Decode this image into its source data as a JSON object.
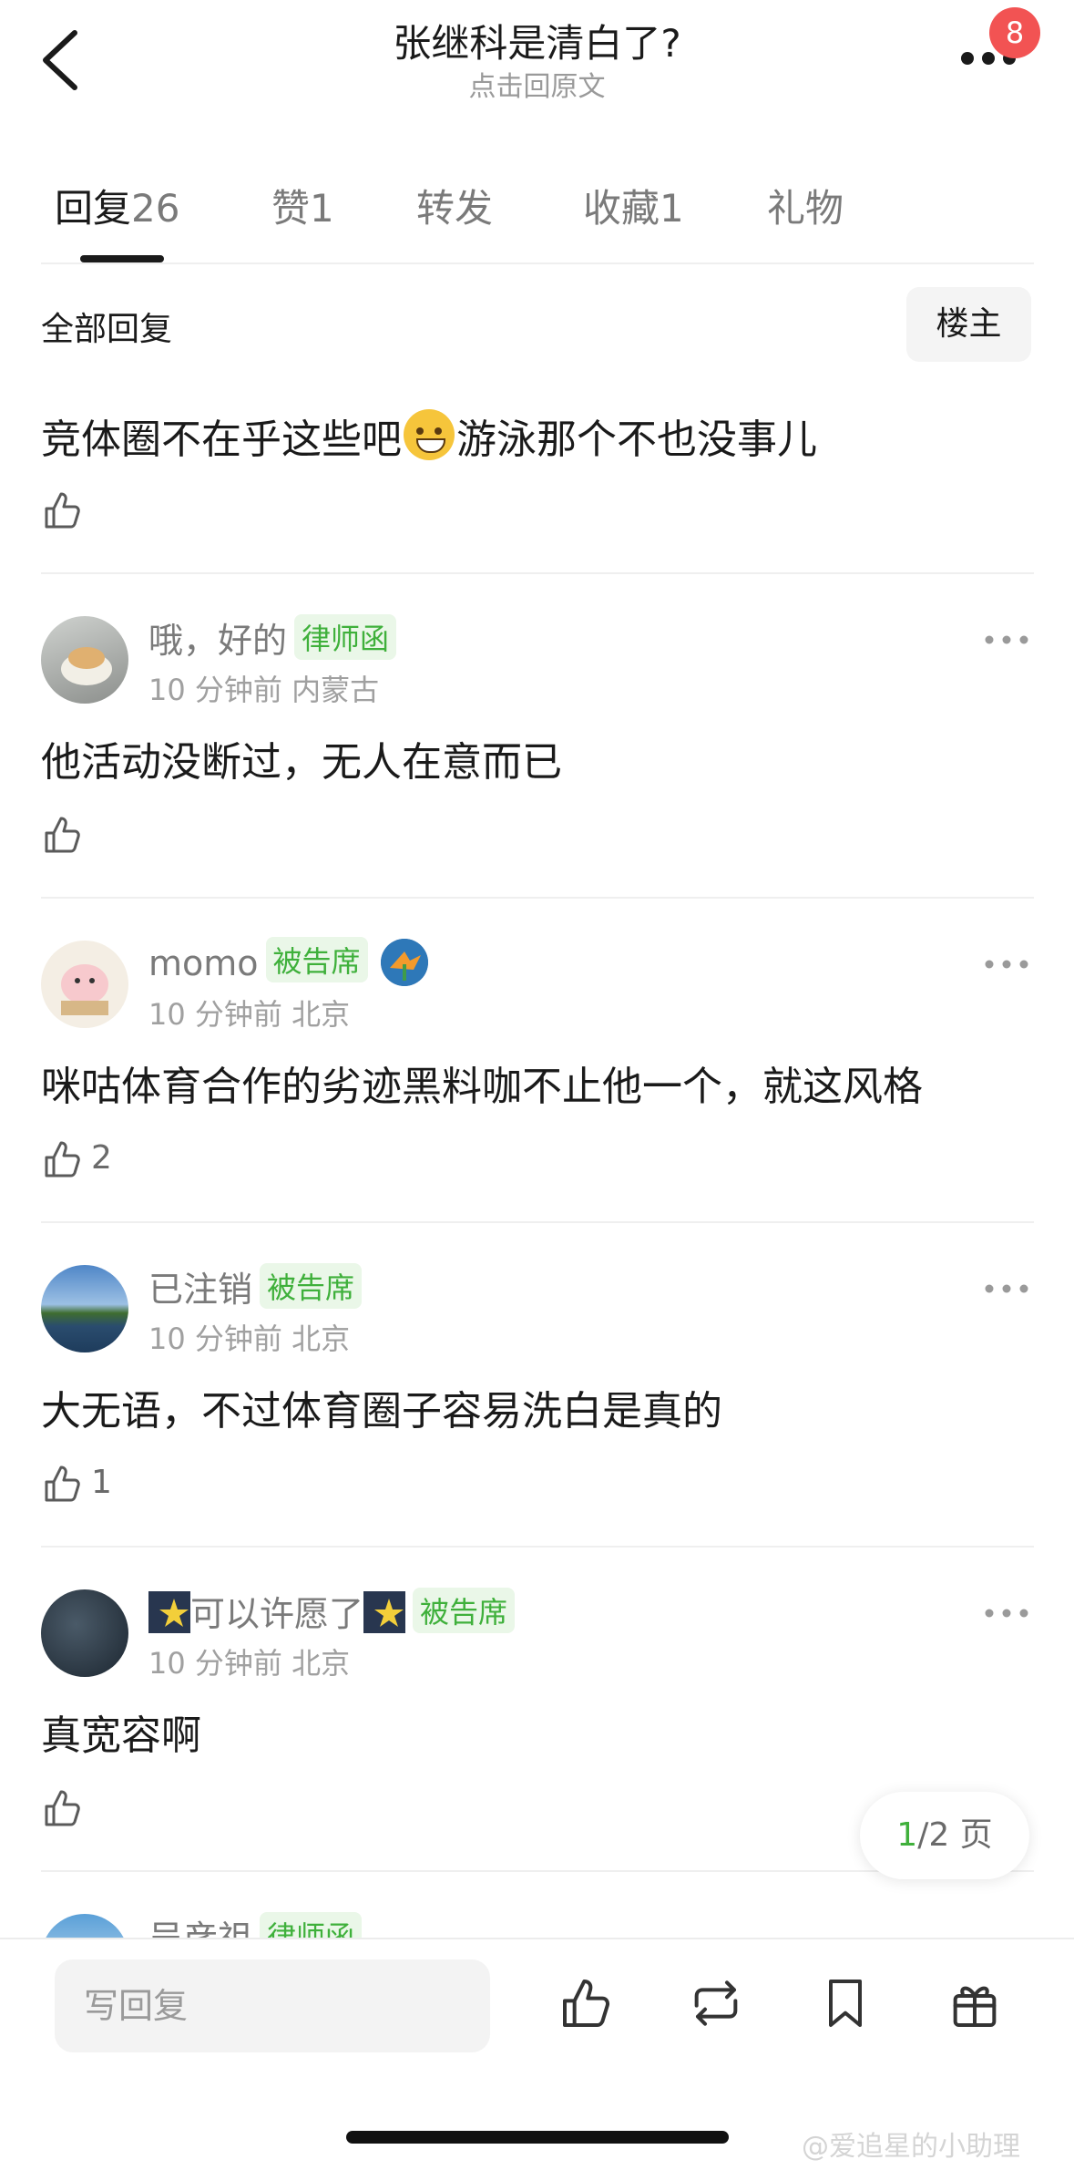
{
  "header": {
    "title": "张继科是清白了?",
    "subtitle": "点击回原文",
    "notification_count": "8"
  },
  "tabs": [
    {
      "label": "回复",
      "count": "26"
    },
    {
      "label": "赞",
      "count": "1"
    },
    {
      "label": "转发",
      "count": ""
    },
    {
      "label": "收藏",
      "count": "1"
    },
    {
      "label": "礼物",
      "count": ""
    }
  ],
  "filter": {
    "label": "全部回复",
    "op_button": "楼主"
  },
  "first_reply": {
    "text_before": "竞体圈不在乎这些吧",
    "text_after": "游泳那个不也没事儿"
  },
  "comments": [
    {
      "name": "哦，好的",
      "tag": "律师函",
      "meta": "10 分钟前 内蒙古",
      "text": "他活动没断过，无人在意而已",
      "likes": ""
    },
    {
      "name": "momo",
      "tag": "被告席",
      "meta": "10 分钟前 北京",
      "text": "咪咕体育合作的劣迹黑料咖不止他一个，就这风格",
      "likes": "2"
    },
    {
      "name": "已注销",
      "tag": "被告席",
      "meta": "10 分钟前 北京",
      "text": "大无语，不过体育圈子容易洗白是真的",
      "likes": "1"
    },
    {
      "name": "可以许愿了",
      "tag": "被告席",
      "meta": "10 分钟前 北京",
      "text": "真宽容啊",
      "likes": ""
    },
    {
      "name": "吴彦祖",
      "tag": "律师函",
      "meta": "",
      "text": "",
      "likes": ""
    }
  ],
  "pager": {
    "current": "1",
    "rest": "/2 页"
  },
  "bottom_bar": {
    "reply_placeholder": "写回复"
  },
  "watermark": "@爱追星的小助理",
  "colors": {
    "accent_green": "#3fb03b",
    "badge_red": "#f25353",
    "tag_bg": "#eaf7e8"
  }
}
